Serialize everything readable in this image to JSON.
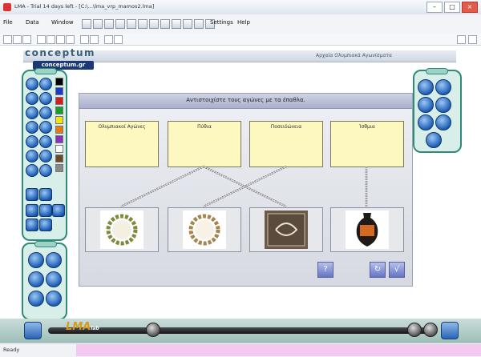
{
  "window": {
    "title": "LMA - Trial 14 days left - [C:\\...\\lma_vrp_mamos2.lma]"
  },
  "menubar": {
    "items": [
      "File",
      "Data",
      "Window",
      "Settings",
      "Help"
    ]
  },
  "logo": {
    "wordmark": "conceptum",
    "url": "conceptum.gr"
  },
  "header": {
    "subtitle": "Αρχαία Ολυμπιακά Αγωνίσματα"
  },
  "activity": {
    "question": "Αντιστοιχίστε τους αγώνες με τα έπαθλα.",
    "categories": [
      {
        "label": "Ολυμπιακοί Αγώνες"
      },
      {
        "label": "Πύθια"
      },
      {
        "label": "Ποσειδώνεια"
      },
      {
        "label": "Ίσθμια"
      }
    ],
    "images": [
      {
        "name": "olive-wreath-image"
      },
      {
        "name": "laurel-wreath-image"
      },
      {
        "name": "embroidered-cloth-image"
      },
      {
        "name": "amphora-image"
      }
    ],
    "connections": [
      {
        "from": 2,
        "to": 1
      },
      {
        "from": 1,
        "to": 3
      },
      {
        "from": 3,
        "to": 4
      }
    ],
    "buttons": {
      "hint": "?",
      "reset": "↻",
      "check": "√"
    }
  },
  "bottombar": {
    "brand": "LMA",
    "brand_sub": "lab"
  },
  "statusbar": {
    "text": "Ready"
  }
}
